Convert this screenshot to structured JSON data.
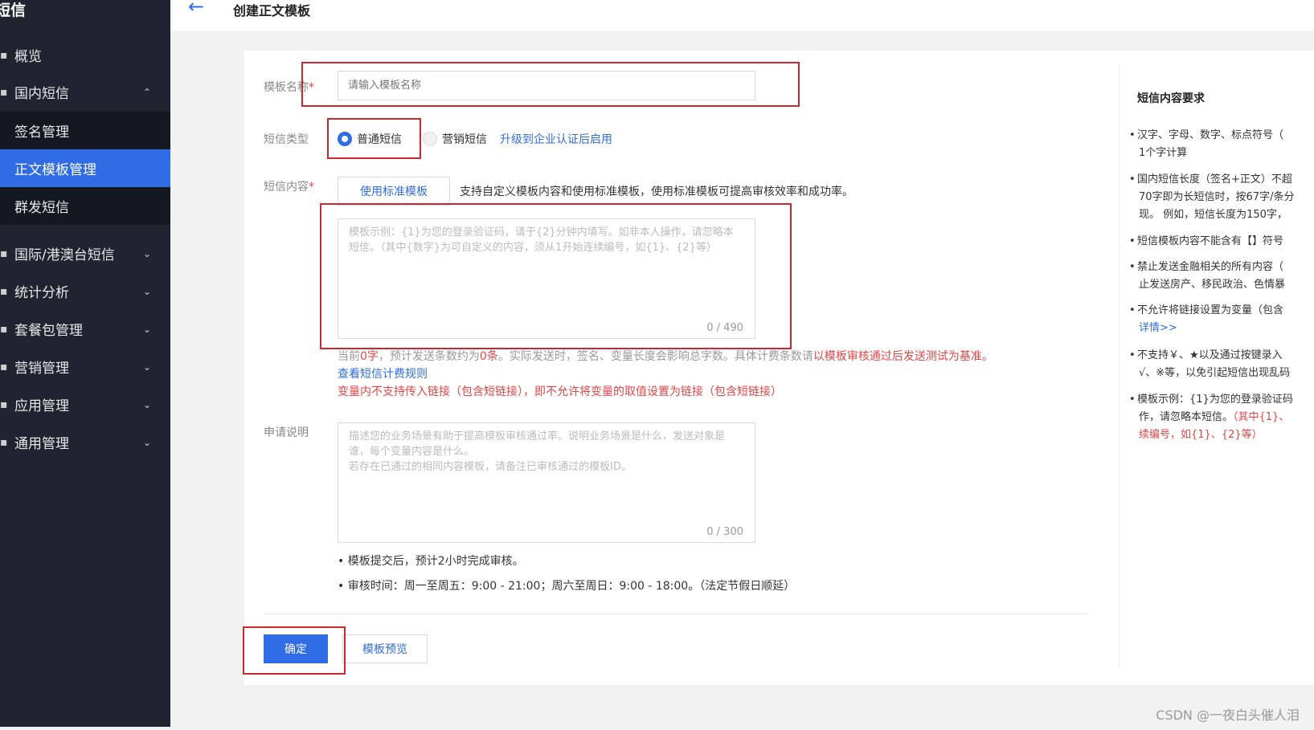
{
  "sidebar": {
    "title": "短信",
    "items": [
      {
        "label": "概览",
        "icon": "overview-icon",
        "chevron": ""
      },
      {
        "label": "国内短信",
        "icon": "sms-icon",
        "chevron": "⌃"
      },
      {
        "label": "签名管理"
      },
      {
        "label": "正文模板管理"
      },
      {
        "label": "群发短信"
      },
      {
        "label": "国际/港澳台短信",
        "icon": "globe-icon",
        "chevron": "⌄"
      },
      {
        "label": "统计分析",
        "icon": "chart-icon",
        "chevron": "⌄"
      },
      {
        "label": "套餐包管理",
        "icon": "package-icon",
        "chevron": "⌄"
      },
      {
        "label": "营销管理",
        "icon": "marketing-icon",
        "chevron": "⌄"
      },
      {
        "label": "应用管理",
        "icon": "app-icon",
        "chevron": "⌄"
      },
      {
        "label": "通用管理",
        "icon": "settings-icon",
        "chevron": "⌄"
      }
    ]
  },
  "header": {
    "back_icon": "←",
    "title": "创建正文模板"
  },
  "form": {
    "name_label": "模板名称",
    "required_mark": "*",
    "name_placeholder": "请输入模板名称",
    "type_label": "短信类型",
    "type_option_normal": "普通短信",
    "type_option_marketing": "营销短信",
    "type_upgrade_link": "升级到企业认证后启用",
    "content_label": "短信内容",
    "use_standard_button": "使用标准模板",
    "content_hint": "支持自定义模板内容和使用标准模板，使用标准模板可提高审核效率和成功率。",
    "content_placeholder": "模板示例：{1}为您的登录验证码，请于{2}分钟内填写。如非本人操作，请忽略本短信。（其中{数字}为可自定义的内容，须从1开始连续编号，如{1}、{2}等）",
    "content_count": "0 / 490",
    "stats_prefix": "当前",
    "stats_chars": "0字",
    "stats_mid": "，预计发送条数约为",
    "stats_count": "0条",
    "stats_suffix": "。实际发送时，签名、变量长度会影响总字数。具体计费条数请",
    "stats_red": "以模板审核通过后发送测试为基准。",
    "billing_link": "查看短信计费规则",
    "variable_warning": "变量内不支持传入链接（包含短链接），即不允许将变量的取值设置为链接（包含短链接）",
    "desc_label": "申请说明",
    "desc_placeholder_1": "描述您的业务场景有助于提高模板审核通过率。说明业务场景是什么，发送对象是谁，每个变量内容是什么。",
    "desc_placeholder_2": "若存在已通过的相同内容模板，请备注已审核通过的模板ID。",
    "desc_count": "0 / 300",
    "note_1": "模板提交后，预计2小时完成审核。",
    "note_2": "审核时间：周一至周五：9:00 - 21:00；周六至周日：9:00 - 18:00。（法定节假日顺延）",
    "confirm_button": "确定",
    "preview_button": "模板预览"
  },
  "requirements": {
    "title": "短信内容要求",
    "r1_a": "汉字、字母、数字、标点符号（",
    "r1_b": "1个字计算",
    "r2_a": "国内短信长度（签名+正文）不超",
    "r2_b": "70字即为长短信时，按67字/条分",
    "r2_c": "现。 例如，短信长度为150字，",
    "r3": "短信模板内容不能含有【】符号",
    "r4_a": "禁止发送金融相关的所有内容（",
    "r4_b": "止发送房产、移民政治、色情暴",
    "r5_a": "不允许将链接设置为变量（包含",
    "r5_b": "详情>>",
    "r6_a": "不支持￥、★以及通过按键录入",
    "r6_b": "√、※等，以免引起短信出现乱码",
    "r7_a": "模板示例：{1}为您的登录验证码",
    "r7_b_black": "作，请忽略本短信。",
    "r7_b_red": "（其中{1}、",
    "r7_c": "续编号，如{1}、{2}等）"
  },
  "watermark": "CSDN @一夜白头催人泪"
}
